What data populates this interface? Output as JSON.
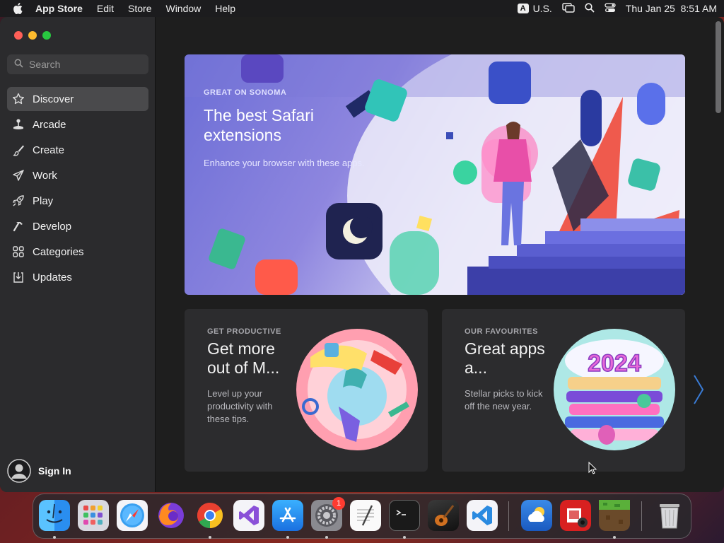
{
  "menubar": {
    "app_name": "App Store",
    "menus": [
      "Edit",
      "Store",
      "Window",
      "Help"
    ],
    "input_badge": "A",
    "input_source": "U.S.",
    "datetime": "Thu Jan 25  8:51 AM"
  },
  "sidebar": {
    "search_placeholder": "Search",
    "items": [
      {
        "label": "Discover",
        "icon": "star-icon",
        "active": true
      },
      {
        "label": "Arcade",
        "icon": "joystick-icon"
      },
      {
        "label": "Create",
        "icon": "brush-icon"
      },
      {
        "label": "Work",
        "icon": "paper-plane-icon"
      },
      {
        "label": "Play",
        "icon": "rocket-icon"
      },
      {
        "label": "Develop",
        "icon": "hammer-icon"
      },
      {
        "label": "Categories",
        "icon": "grid-icon"
      },
      {
        "label": "Updates",
        "icon": "download-icon"
      }
    ],
    "sign_in": "Sign In"
  },
  "hero": {
    "eyebrow": "GREAT ON SONOMA",
    "title": "The best Safari extensions",
    "subtitle": "Enhance your browser with these apps."
  },
  "cards": [
    {
      "eyebrow": "GET PRODUCTIVE",
      "title": "Get more out of M...",
      "subtitle": "Level up your productivity with these tips."
    },
    {
      "eyebrow": "OUR FAVOURITES",
      "title": "Great apps a...",
      "subtitle": "Stellar picks to kick off the new year.",
      "art_text": "2024"
    }
  ],
  "dock": {
    "apps": [
      {
        "name": "Finder",
        "icon": "finder-icon",
        "running": true
      },
      {
        "name": "Launchpad",
        "icon": "launchpad-icon",
        "running": false
      },
      {
        "name": "Safari",
        "icon": "safari-icon",
        "running": false
      },
      {
        "name": "Firefox",
        "icon": "firefox-icon",
        "running": false
      },
      {
        "name": "Chrome",
        "icon": "chrome-icon",
        "running": true
      },
      {
        "name": "Visual Studio",
        "icon": "visual-studio-icon",
        "running": false
      },
      {
        "name": "App Store",
        "icon": "app-store-icon",
        "running": true
      },
      {
        "name": "System Settings",
        "icon": "settings-icon",
        "running": true,
        "badge": "1"
      },
      {
        "name": "TextEdit",
        "icon": "textedit-icon",
        "running": false
      },
      {
        "name": "Terminal",
        "icon": "terminal-icon",
        "running": true
      },
      {
        "name": "GarageBand",
        "icon": "garageband-icon",
        "running": false
      },
      {
        "name": "VS Code",
        "icon": "vscode-icon",
        "running": false
      },
      {
        "name": "Weather",
        "icon": "weather-icon",
        "running": false
      },
      {
        "name": "Photo Booth",
        "icon": "photo-booth-icon",
        "running": false
      },
      {
        "name": "Minecraft",
        "icon": "minecraft-icon",
        "running": true
      },
      {
        "name": "Trash",
        "icon": "trash-icon",
        "running": false
      }
    ]
  },
  "colors": {
    "sidebar_bg": "#2b2b2d",
    "main_bg": "#1e1e1e",
    "active_item": "#4a4a4c",
    "accent_chevron": "#3a7bd5"
  }
}
